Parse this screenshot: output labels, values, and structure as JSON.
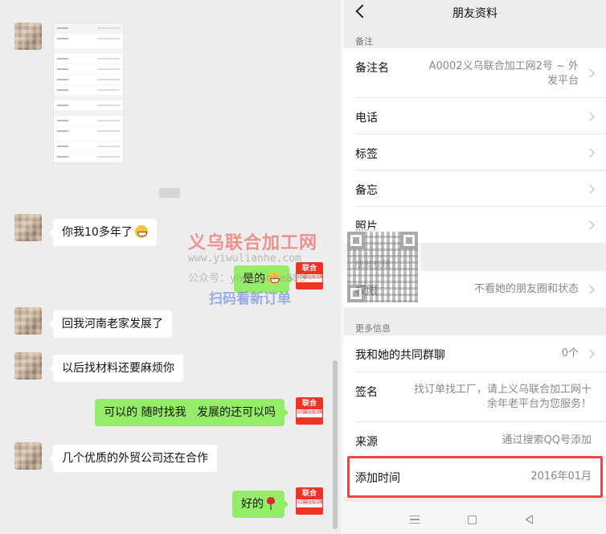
{
  "chat": {
    "messages": [
      {
        "side": "in",
        "text": "你我10多年了"
      },
      {
        "side": "out",
        "text": "是的"
      },
      {
        "side": "in",
        "text": "回我河南老家发展了"
      },
      {
        "side": "in",
        "text": "以后找材料还要麻烦你"
      },
      {
        "side": "out",
        "text": "可以的 随时找我   发展的还可以吗"
      },
      {
        "side": "in",
        "text": "几个优质的外贸公司还在合作"
      },
      {
        "side": "out",
        "text": "好的"
      }
    ],
    "brand_logo": {
      "top": "联合",
      "bottom": "义乌联合加工网"
    }
  },
  "watermark": {
    "title": "义乌联合加工网",
    "url": "www.yiwulianhe.com",
    "gzh": "公众号：yiwulianhe888",
    "scan": "扫码看新订单"
  },
  "profile": {
    "nav_title": "朋友资料",
    "section_remark": "备注",
    "remark_name_label": "备注名",
    "remark_name_value": "A0002义乌联合加工网2号 ~ 外发平台",
    "phone_label": "电话",
    "tag_label": "标签",
    "memo_label": "备忘",
    "photo_label": "照片",
    "section_permission": "朋友权限",
    "permission_label": "权限",
    "permission_value": "不看她的朋友圈和状态",
    "section_more": "更多信息",
    "groups_label": "我和她的共同群聊",
    "groups_value": "0个",
    "signature_label": "签名",
    "signature_value": "找订单找工厂，请上义乌联合加工网十余年老平台为您服务！",
    "source_label": "来源",
    "source_value": "通过搜索QQ号添加",
    "added_time_label": "添加时间",
    "added_time_value": "2016年01月"
  },
  "colors": {
    "highlight": "#e94848",
    "bubble_out": "#95ec69",
    "brand_red": "#e32222"
  }
}
